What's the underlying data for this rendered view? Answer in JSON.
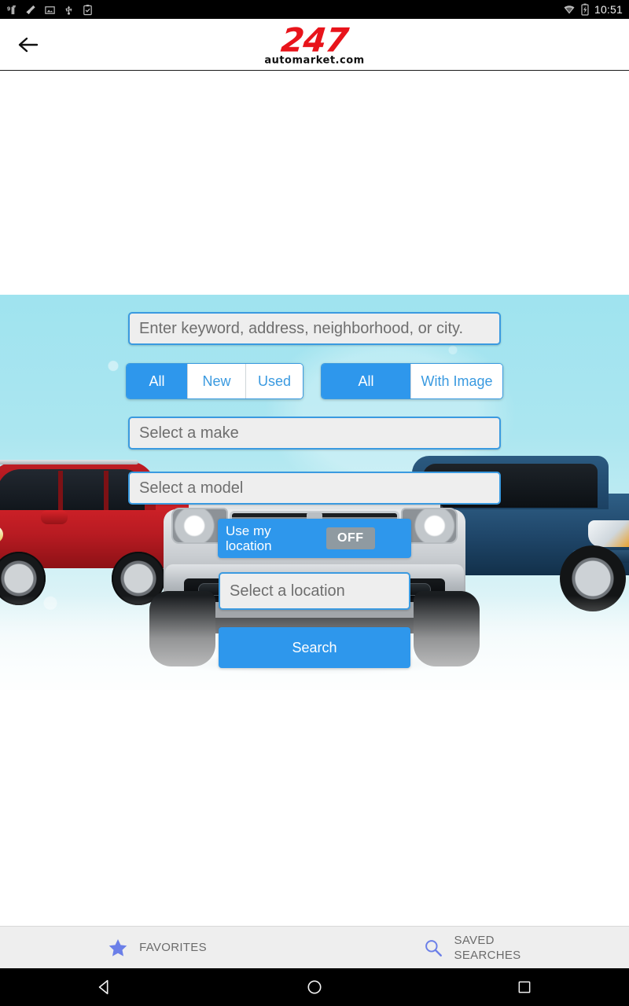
{
  "status_bar": {
    "time": "10:51",
    "left_icons": [
      "notification-icon",
      "broom-icon",
      "screenshot-icon",
      "usb-icon",
      "clipboard-check-icon"
    ],
    "right_icons": [
      "wifi-icon",
      "battery-charging-icon"
    ]
  },
  "header": {
    "back_icon": "back-arrow-icon",
    "logo_primary": "247",
    "logo_secondary": "automarket.com",
    "logo_color": "#e8141b"
  },
  "search_form": {
    "keyword": {
      "value": "",
      "placeholder": "Enter keyword, address, neighborhood, or city."
    },
    "condition_group": {
      "options": [
        "All",
        "New",
        "Used"
      ],
      "selected": "All"
    },
    "image_group": {
      "options": [
        "All",
        "With Image"
      ],
      "selected": "All"
    },
    "make": {
      "value": "",
      "placeholder": "Select a make"
    },
    "model": {
      "value": "",
      "placeholder": "Select a model"
    },
    "use_my_location": {
      "label": "Use my location",
      "label_line1": "Use my",
      "label_line2": "location",
      "state": "OFF"
    },
    "location": {
      "value": "",
      "placeholder": "Select a location"
    },
    "search_button": "Search",
    "accent_color": "#2e97ec"
  },
  "bottom_bar": {
    "items": [
      {
        "label": "FAVORITES",
        "icon": "star-icon",
        "icon_color": "#6b7fe8"
      },
      {
        "label_line1": "SAVED",
        "label_line2": "SEARCHES",
        "icon": "search-icon",
        "icon_color": "#6b7fe8"
      }
    ]
  },
  "nav_bar": {
    "buttons": [
      "back-triangle-icon",
      "home-circle-icon",
      "recents-square-icon"
    ]
  }
}
